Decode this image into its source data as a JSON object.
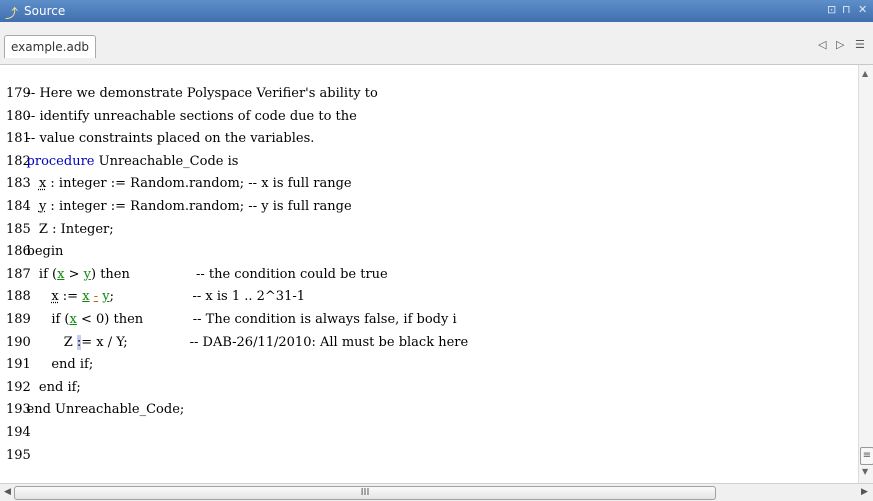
{
  "window": {
    "title": "Source",
    "buttons": [
      "⊡",
      "⊓",
      "✕"
    ]
  },
  "tabs": [
    {
      "label": "example.adb"
    }
  ],
  "tab_nav": {
    "prev": "◁",
    "next": "▷",
    "list": "☰"
  },
  "lines": [
    {
      "num": "179",
      "segments": [
        {
          "t": "    -- Here we demonstrate Polyspace Verifier's ability to"
        }
      ]
    },
    {
      "num": "180",
      "segments": [
        {
          "t": "    -- identify unreachable sections of code due to the"
        }
      ]
    },
    {
      "num": "181",
      "segments": [
        {
          "t": "    -- value constraints placed on the variables."
        }
      ]
    },
    {
      "num": "182",
      "segments": [
        {
          "t": "    "
        },
        {
          "t": "procedure",
          "c": "kw"
        },
        {
          "t": " Unreachable_Code is"
        }
      ]
    },
    {
      "num": "183",
      "segments": [
        {
          "t": "       "
        },
        {
          "t": "x",
          "c": "ud"
        },
        {
          "t": " : integer := Random.random; -- x is full range"
        }
      ]
    },
    {
      "num": "184",
      "segments": [
        {
          "t": "       "
        },
        {
          "t": "y",
          "c": "ud"
        },
        {
          "t": " : integer := Random.random; -- y is full range"
        }
      ]
    },
    {
      "num": "185",
      "segments": [
        {
          "t": "       Z : Integer;"
        }
      ]
    },
    {
      "num": "186",
      "segments": [
        {
          "t": "    begin"
        }
      ]
    },
    {
      "num": "187",
      "segments": [
        {
          "t": "       if ("
        },
        {
          "t": "x",
          "c": "ug"
        },
        {
          "t": " > "
        },
        {
          "t": "y",
          "c": "ug"
        },
        {
          "t": ") then                -- the condition could be true"
        }
      ]
    },
    {
      "num": "188",
      "segments": [
        {
          "t": "          "
        },
        {
          "t": "x",
          "c": "ud"
        },
        {
          "t": " := "
        },
        {
          "t": "x",
          "c": "ug"
        },
        {
          "t": " "
        },
        {
          "t": "-",
          "c": "uo"
        },
        {
          "t": " "
        },
        {
          "t": "y",
          "c": "ug"
        },
        {
          "t": ";                   -- x is 1 .. 2^31-1"
        }
      ]
    },
    {
      "num": "189",
      "segments": [
        {
          "t": "          if ("
        },
        {
          "t": "x",
          "c": "ug"
        },
        {
          "t": " < 0) then            -- The condition is always false, if body i"
        }
      ]
    },
    {
      "num": "190",
      "segments": [
        {
          "t": "             Z "
        },
        {
          "t": ":",
          "c": "sel"
        },
        {
          "t": "= x / Y;               -- DAB-26/11/2010: All must be black here"
        }
      ]
    },
    {
      "num": "191",
      "segments": [
        {
          "t": "          end if;"
        }
      ]
    },
    {
      "num": "192",
      "segments": [
        {
          "t": "       end if;"
        }
      ]
    },
    {
      "num": "193",
      "segments": [
        {
          "t": "    end Unreachable_Code;"
        }
      ]
    },
    {
      "num": "194",
      "segments": [
        {
          "t": ""
        }
      ]
    },
    {
      "num": "195",
      "segments": [
        {
          "t": ""
        }
      ]
    }
  ],
  "scrollbars": {
    "up": "▲",
    "down": "▼",
    "left": "◀",
    "right": "▶",
    "grip_v": "≡",
    "grip_h": "III"
  }
}
